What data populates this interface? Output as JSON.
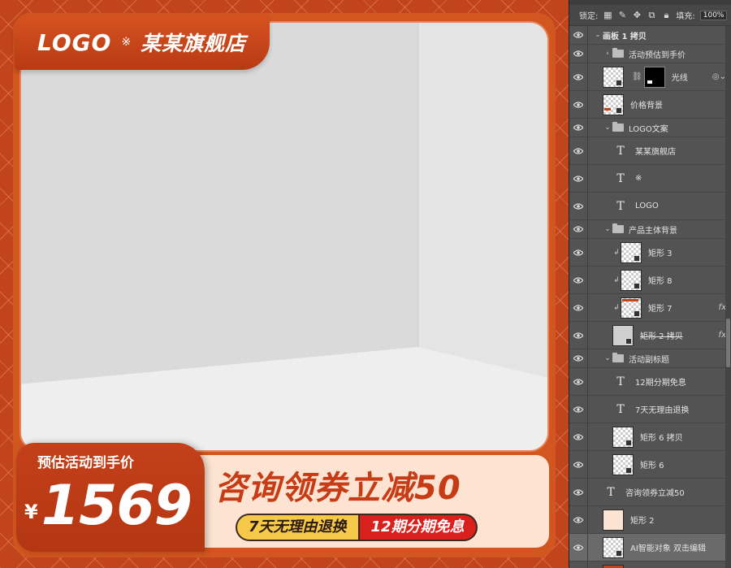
{
  "canvas": {
    "logo_text": "LOGO",
    "logo_separator": "※",
    "store_name": "某某旗舰店",
    "price_caption": "预估活动到手价",
    "price_currency": "¥",
    "price_value": "1569",
    "promo_headline": "咨询领券立减50",
    "badge_return": "7天无理由退换",
    "badge_installment": "12期分期免息",
    "colors": {
      "brand_red": "#c2441c",
      "panel_peach": "#fde4d2",
      "badge_yellow": "#f6c94a",
      "badge_red": "#d8201c"
    }
  },
  "layers_panel": {
    "lock_label": "锁定:",
    "fill_label": "填充:",
    "fill_value": "100%",
    "lock_icons": [
      "lock-transparent-icon",
      "lock-paint-icon",
      "move-icon",
      "artboard-icon",
      "lock-all-icon"
    ],
    "layers": [
      {
        "name": "画板 1 拷贝",
        "kind": "artboard",
        "caret": "⌄",
        "indent": 0
      },
      {
        "name": "活动预估到手价",
        "kind": "group",
        "caret": "›",
        "indent": 1
      },
      {
        "name": "光线",
        "kind": "masked",
        "indent": 1,
        "right": "◎⌄"
      },
      {
        "name": "价格背景",
        "kind": "smart",
        "indent": 1
      },
      {
        "name": "LOGO文案",
        "kind": "group",
        "caret": "⌄",
        "indent": 1
      },
      {
        "name": "某某旗舰店",
        "kind": "text",
        "indent": 2
      },
      {
        "name": "※",
        "kind": "text",
        "indent": 2
      },
      {
        "name": "LOGO",
        "kind": "text",
        "indent": 2
      },
      {
        "name": "产品主体背景",
        "kind": "group",
        "caret": "⌄",
        "indent": 1
      },
      {
        "name": "矩形 3",
        "kind": "clip",
        "indent": 2
      },
      {
        "name": "矩形 8",
        "kind": "clip",
        "indent": 2
      },
      {
        "name": "矩形 7",
        "kind": "clip-red",
        "indent": 2,
        "right": "fx"
      },
      {
        "name": "矩形 2 拷贝",
        "kind": "smart-gray",
        "indent": 2,
        "right": "fx",
        "strike": true
      },
      {
        "name": "活动副标题",
        "kind": "group",
        "caret": "⌄",
        "indent": 1
      },
      {
        "name": "12期分期免息",
        "kind": "text",
        "indent": 2
      },
      {
        "name": "7天无理由退换",
        "kind": "text",
        "indent": 2
      },
      {
        "name": "矩形 6 拷贝",
        "kind": "smart",
        "indent": 2
      },
      {
        "name": "矩形 6",
        "kind": "smart",
        "indent": 2
      },
      {
        "name": "咨询领券立减50",
        "kind": "text",
        "indent": 1
      },
      {
        "name": "矩形 2",
        "kind": "peach",
        "indent": 1
      },
      {
        "name": "AI智能对象 双击编辑",
        "kind": "smart",
        "indent": 1,
        "selected": true
      },
      {
        "name": "",
        "kind": "red",
        "indent": 1
      }
    ]
  }
}
